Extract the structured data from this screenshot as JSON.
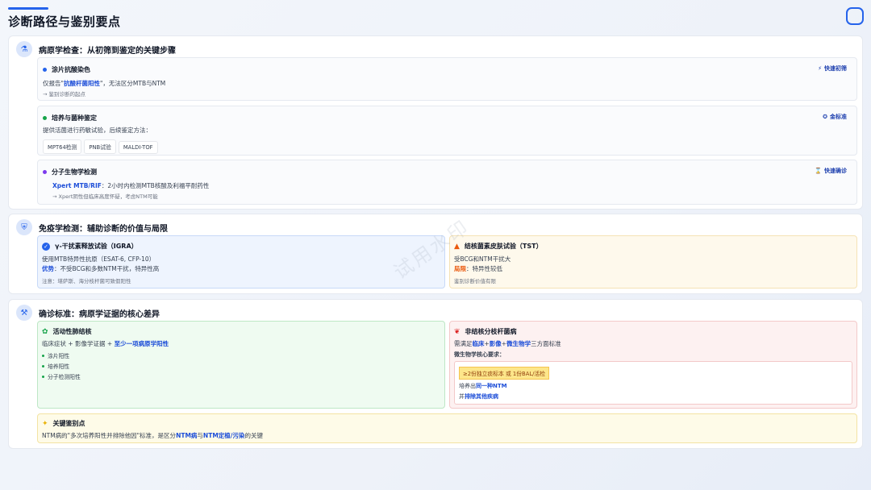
{
  "page": {
    "title": "诊断路径与鉴别要点",
    "watermark": "试用水印"
  },
  "colors": {
    "accent": "#2563eb",
    "green": "#16a34a",
    "purple": "#7c3aed",
    "orange": "#ea580c",
    "red": "#dc2626"
  },
  "sec1": {
    "title": "病原学检查：从初筛到鉴定的关键步骤",
    "icon": "microscope-icon",
    "smear": {
      "title": "涂片抗酸染色",
      "tag": "快速初筛",
      "line_pre": "仅报告\"",
      "line_hl": "抗酸杆菌阳性",
      "line_post": "\"，无法区分MTB与NTM",
      "note": "→ 鉴别诊断的起点"
    },
    "culture": {
      "title": "培养与菌种鉴定",
      "tag": "金标准",
      "line": "提供活菌进行药敏试验，后续鉴定方法：",
      "pills": [
        "MPT64检测",
        "PNB试验",
        "MALDI-TOF"
      ]
    },
    "molecular": {
      "title": "分子生物学检测",
      "tag": "快速确诊",
      "line_hl": "Xpert MTB/RIF",
      "line_post": "：2小时内检测MTB核酸及利福平耐药性",
      "note": "→ Xpert阴性但临床高度怀疑，考虑NTM可能"
    }
  },
  "sec2": {
    "title": "免疫学检测：辅助诊断的价值与局限",
    "icon": "shield-icon",
    "igra": {
      "title": "γ-干扰素释放试验（IGRA）",
      "line1": "使用MTB特异性抗原（ESAT-6, CFP-10）",
      "adv_label": "优势",
      "adv_text": "：不受BCG和多数NTM干扰，特异性高",
      "note": "注意：堪萨斯、海分枝杆菌可致假阳性"
    },
    "tst": {
      "title": "结核菌素皮肤试验（TST）",
      "line1": "受BCG和NTM干扰大",
      "lim_label": "局限",
      "lim_text": "：特异性较低",
      "note": "鉴别诊断价值有限"
    }
  },
  "sec3": {
    "title": "确诊标准：病原学证据的核心差异",
    "icon": "gavel-icon",
    "tb": {
      "title": "活动性肺结核",
      "line_pre": "临床症状 + 影像学证据 + ",
      "line_hl": "至少一项病原学阳性",
      "bullets": [
        "涂片阳性",
        "培养阳性",
        "分子检测阳性"
      ]
    },
    "ntm": {
      "title": "非结核分枝杆菌病",
      "line_pre": "需满足",
      "line_hl1": "临床",
      "line_plus1": "+",
      "line_hl2": "影像",
      "line_plus2": "+",
      "line_hl3": "微生物学",
      "line_post": "三方面标准",
      "sub": "微生物学核心要求：",
      "box_highlight": "≥2份独立痰标本 或 1份BAL/活检",
      "box_line1_pre": "培养出",
      "box_line1_hl": "同一种NTM",
      "box_line2_pre": "并",
      "box_line2_hl": "排除其他疾病"
    },
    "key": {
      "title": "关键鉴别点",
      "line_pre": "NTM病的\"多次培养阳性并排除他因\"标准，是区分",
      "line_hl1": "NTM病",
      "line_mid": "与",
      "line_hl2": "NTM定植/污染",
      "line_post": "的关键"
    }
  }
}
